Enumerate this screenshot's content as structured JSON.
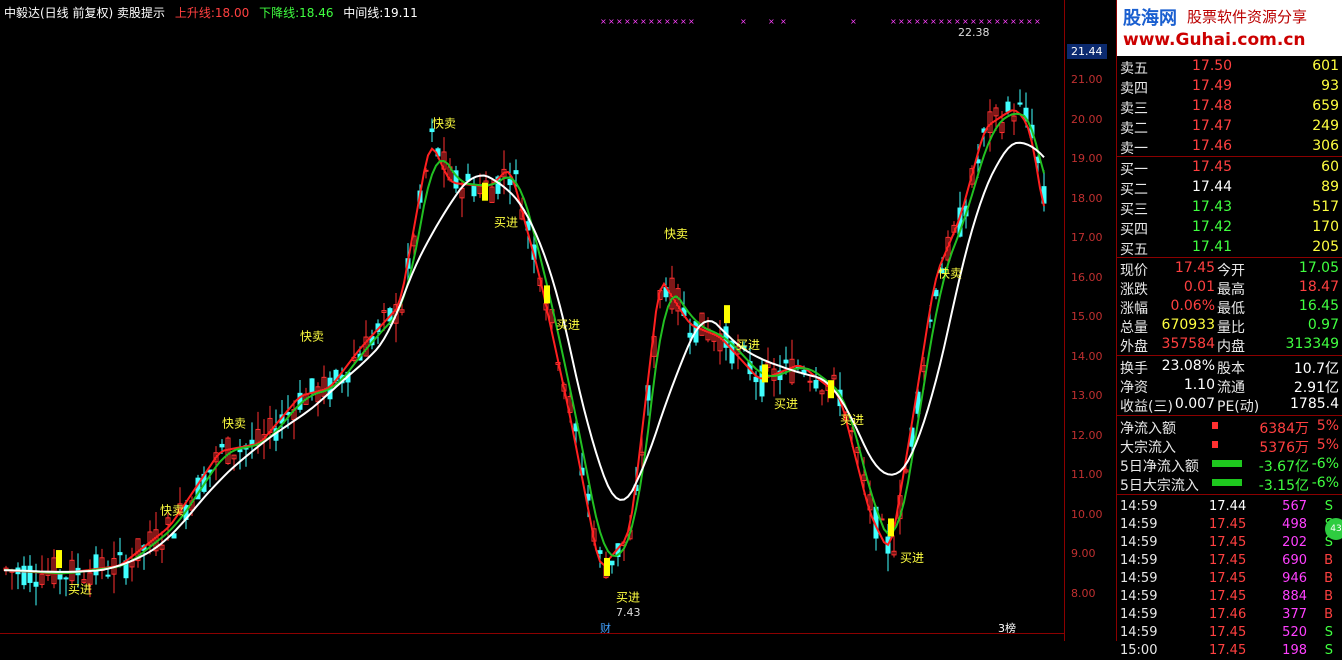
{
  "title_bar": {
    "name": "中毅达(日线 前复权) 卖股提示",
    "up_label": "上升线:",
    "up_value": "18.00",
    "down_label": "下降线:",
    "down_value": "18.46",
    "mid_label": "中间线:",
    "mid_value": "19.11"
  },
  "axis": {
    "current_tag": "21.44",
    "ticks": [
      "21.00",
      "20.00",
      "19.00",
      "18.00",
      "17.00",
      "16.00",
      "15.00",
      "14.00",
      "13.00",
      "12.00",
      "11.00",
      "10.00",
      "9.00",
      "8.00"
    ]
  },
  "annotations": {
    "buy": "买进",
    "sell": "快卖",
    "hi_label": "22.38",
    "lo_label": "7.43",
    "cai": "财",
    "sell_buy": "卖",
    "bottom_tag": "3榜"
  },
  "logo": {
    "site": "股海网",
    "slogan": "股票软件资源分享",
    "url": "www.Guhai.com.cn"
  },
  "colors": {
    "up": "#ff3030",
    "down": "#40ffff",
    "mid": "#ffffff",
    "green": "#22c022",
    "yellow": "#ffff00",
    "magenta": "#ff40ff"
  },
  "order_book": {
    "asks": [
      {
        "label": "卖五",
        "price": "17.50",
        "vol": "601"
      },
      {
        "label": "卖四",
        "price": "17.49",
        "vol": "93"
      },
      {
        "label": "卖三",
        "price": "17.48",
        "vol": "659"
      },
      {
        "label": "卖二",
        "price": "17.47",
        "vol": "249"
      },
      {
        "label": "卖一",
        "price": "17.46",
        "vol": "306"
      }
    ],
    "bids": [
      {
        "label": "买一",
        "price": "17.45",
        "vol": "60"
      },
      {
        "label": "买二",
        "price": "17.44",
        "vol": "89"
      },
      {
        "label": "买三",
        "price": "17.43",
        "vol": "517"
      },
      {
        "label": "买四",
        "price": "17.42",
        "vol": "170"
      },
      {
        "label": "买五",
        "price": "17.41",
        "vol": "205"
      }
    ]
  },
  "quote": {
    "xianjia_l": "现价",
    "xianjia": "17.45",
    "jinkai_l": "今开",
    "jinkai": "17.05",
    "zhangdie_l": "涨跌",
    "zhangdie": "0.01",
    "zuigao_l": "最高",
    "zuigao": "18.47",
    "zhangfu_l": "涨幅",
    "zhangfu": "0.06%",
    "zuidi_l": "最低",
    "zuidi": "16.45",
    "zongliang_l": "总量",
    "zongliang": "670933",
    "liangbi_l": "量比",
    "liangbi": "0.97",
    "waipan_l": "外盘",
    "waipan": "357584",
    "neipan_l": "内盘",
    "neipan": "313349"
  },
  "stats": {
    "huanshou_l": "换手",
    "huanshou": "23.08%",
    "guben_l": "股本",
    "guben": "10.7亿",
    "jingzi_l": "净资",
    "jingzi": "1.10",
    "liutong_l": "流通",
    "liutong": "2.91亿",
    "shouyi_l": "收益(三)",
    "shouyi": "0.007",
    "pe_l": "PE(动)",
    "pe": "1785.4"
  },
  "flows": [
    {
      "label": "净流入额",
      "value": "6384万",
      "pct": "5%"
    },
    {
      "label": "大宗流入",
      "value": "5376万",
      "pct": "5%"
    },
    {
      "label": "5日净流入额",
      "value": "-3.67亿",
      "pct": "-6%"
    },
    {
      "label": "5日大宗流入",
      "value": "-3.15亿",
      "pct": "-6%"
    }
  ],
  "trades": [
    {
      "time": "14:59",
      "price": "17.44",
      "vol": "567",
      "side": "S"
    },
    {
      "time": "14:59",
      "price": "17.45",
      "vol": "498",
      "side": "S"
    },
    {
      "time": "14:59",
      "price": "17.45",
      "vol": "202",
      "side": "S"
    },
    {
      "time": "14:59",
      "price": "17.45",
      "vol": "690",
      "side": "B"
    },
    {
      "time": "14:59",
      "price": "17.45",
      "vol": "946",
      "side": "B"
    },
    {
      "time": "14:59",
      "price": "17.45",
      "vol": "884",
      "side": "B"
    },
    {
      "time": "14:59",
      "price": "17.46",
      "vol": "377",
      "side": "B"
    },
    {
      "time": "14:59",
      "price": "17.45",
      "vol": "520",
      "side": "S"
    },
    {
      "time": "15:00",
      "price": "17.45",
      "vol": "198",
      "side": "S"
    }
  ],
  "badge": "43"
}
